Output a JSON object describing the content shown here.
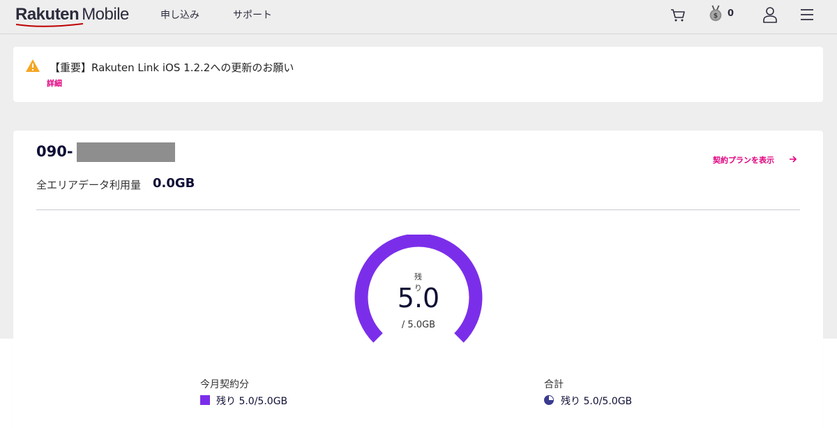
{
  "header": {
    "logo_main": "Rakuten",
    "logo_sub": "Mobile",
    "nav": [
      "申し込み",
      "サポート"
    ],
    "points": "0"
  },
  "notice": {
    "title": "【重要】Rakuten Link iOS 1.2.2への更新のお願い",
    "detail_link": "詳細"
  },
  "account": {
    "phone_prefix": "090-",
    "plan_link": "契約プランを表示",
    "usage_label": "全エリアデータ利用量",
    "usage_value": "0.0GB"
  },
  "gauge": {
    "label": "残り",
    "value": "5.0",
    "total": "/ 5.0GB",
    "remaining_fraction": 1.0
  },
  "legend": [
    {
      "title": "今月契約分",
      "value": "残り 5.0/5.0GB"
    },
    {
      "title": "合計",
      "value": "残り 5.0/5.0GB"
    }
  ],
  "colors": {
    "accent_purple": "#7b2eea",
    "link_pink": "#e0007f",
    "navy": "#0e0e36",
    "warning": "#f5a623"
  }
}
